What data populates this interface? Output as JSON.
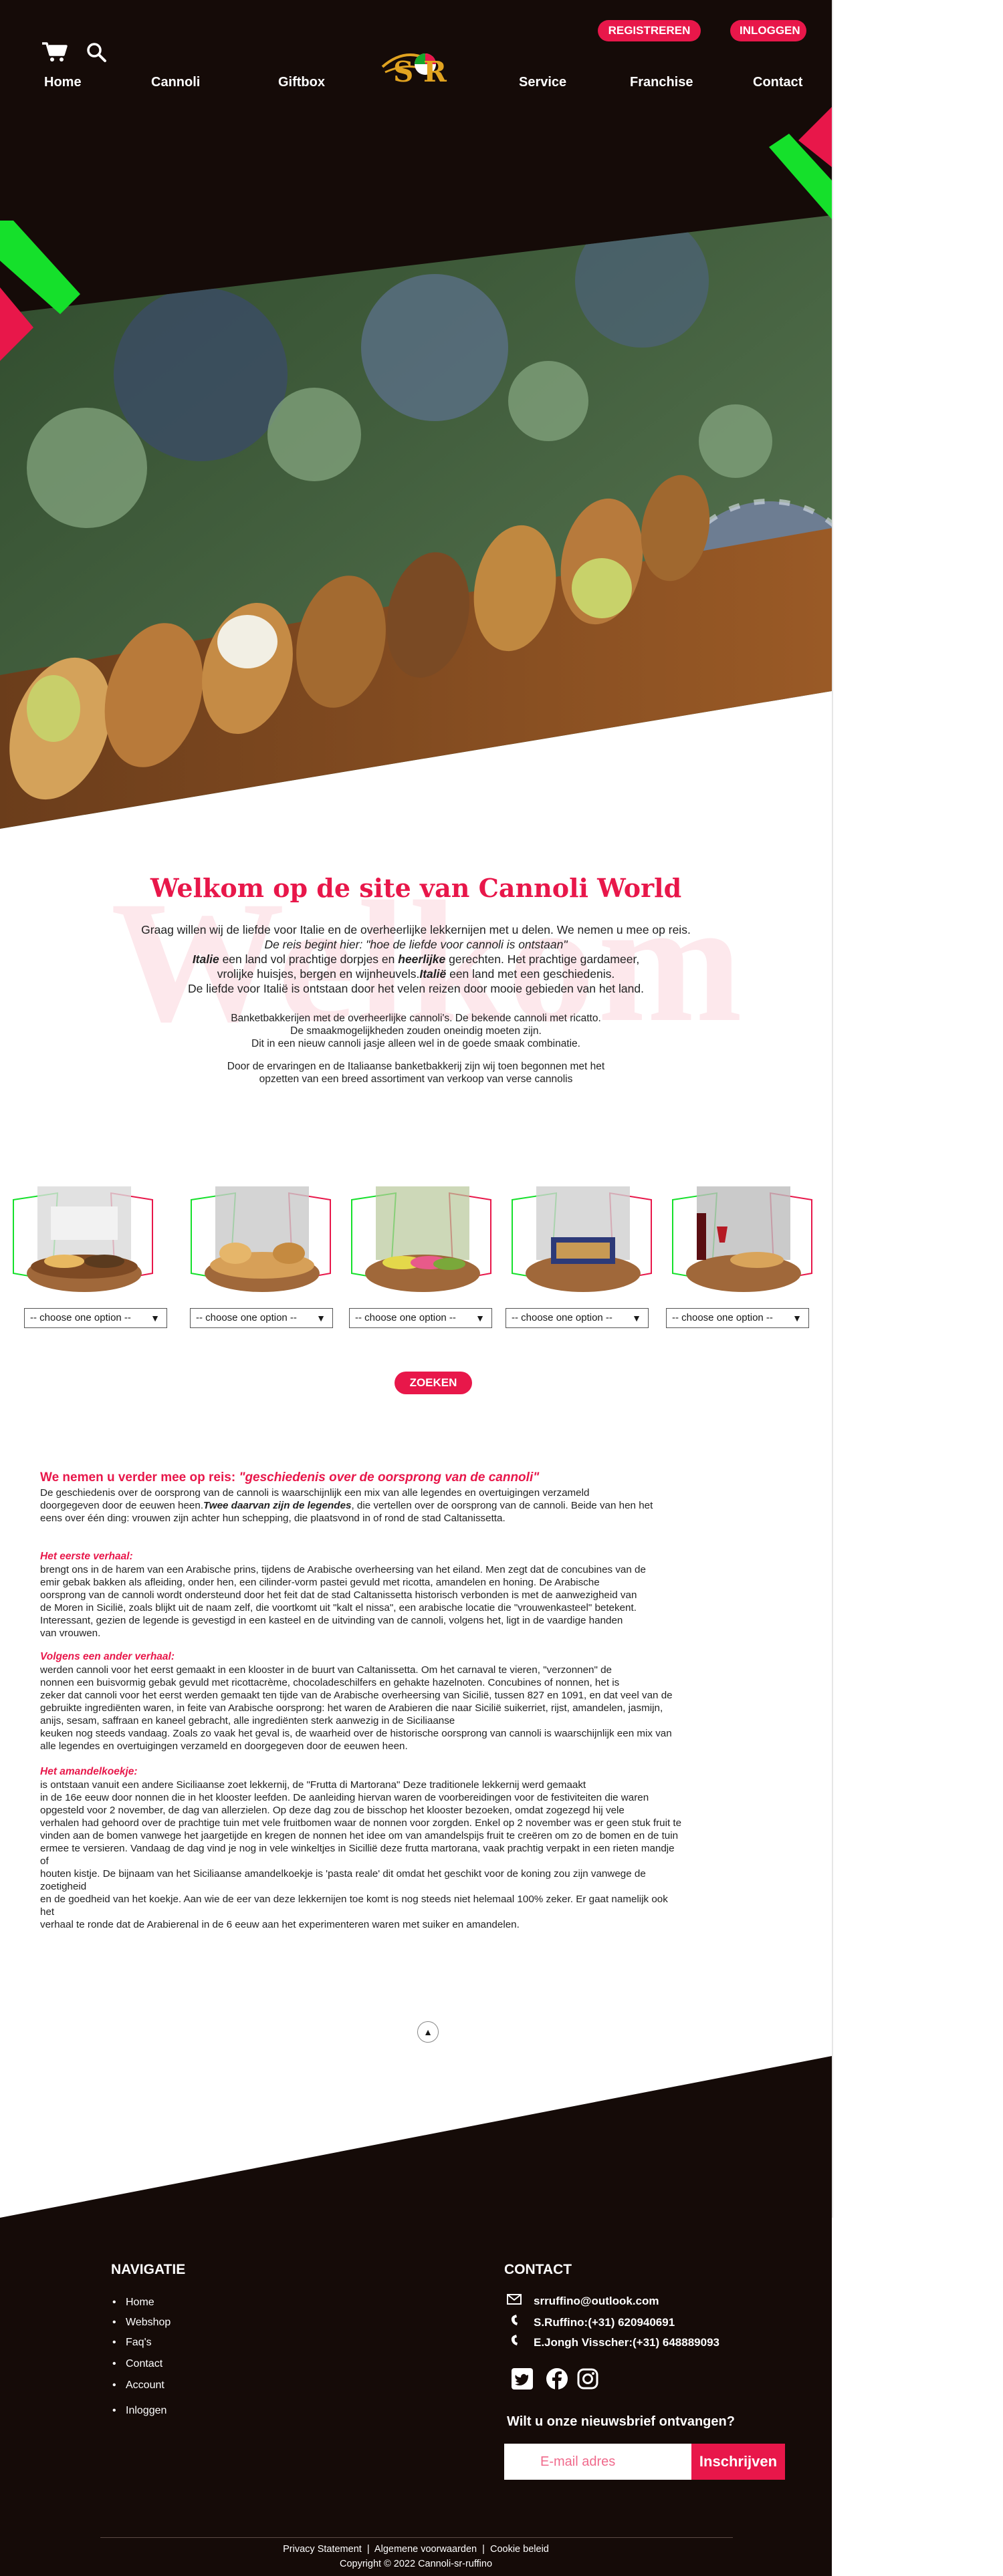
{
  "header": {
    "register_label": "REGISTREREN",
    "login_label": "INLOGGEN",
    "nav": [
      "Home",
      "Cannoli",
      "Giftbox",
      "Service",
      "Franchise",
      "Contact"
    ],
    "logo_letters": "S R"
  },
  "colors": {
    "accent": "#e8174a",
    "dark": "#150b08",
    "green": "#15e02b"
  },
  "welcome": {
    "watermark": "Welkom",
    "title": "Welkom op de site van Cannoli World",
    "p1_l1": "Graag willen wij de liefde voor Italie en de overheerlijke lekkernijen  met u delen. We nemen u mee op reis.",
    "p1_l2": "De reis begint hier: \"hoe de liefde voor cannoli is ontstaan\"",
    "p1_l3a": "Italie",
    "p1_l3b": " een land vol prachtige dorpjes en ",
    "p1_l3c": "heerlijke",
    "p1_l3d": " gerechten. Het prachtige gardameer,",
    "p1_l4a": "vrolijke huisjes, bergen en wijnheuvels.",
    "p1_l4b": "Italië",
    "p1_l4c": "  een land met een geschiedenis.",
    "p1_l5": "De liefde voor Italië is ontstaan door het velen reizen door mooie gebieden van het land.",
    "p2_l1": "Banketbakkerijen met de overheerlijke cannoli's. De bekende cannoli met ricatto.",
    "p2_l2": "De smaakmogelijkheden zouden oneindig moeten zijn.",
    "p2_l3": "Dit in een nieuw cannoli jasje alleen wel in de  goede smaak combinatie.",
    "p3_l1": "Door de ervaringen en de Italiaanse banketbakkerij zijn wij toen begonnen met het",
    "p3_l2": "opzetten van een breed assortiment van verkoop van verse cannolis"
  },
  "products": {
    "select_placeholder": "-- choose one option --",
    "select_arrow": "▼",
    "search_label": "ZOEKEN"
  },
  "history": {
    "h1a": "We nemen u verder mee op reis: ",
    "h1b": "\"geschiedenis over de oorsprong van de cannoli\"",
    "p1": "De geschiedenis over de oorsprong van de cannoli is waarschijnlijk een mix van alle legendes en overtuigingen verzameld",
    "p2a": "doorgegeven door de eeuwen heen.",
    "p2b": "Twee daarvan zijn de legendes",
    "p2c": ",  die vertellen over de oorsprong van de  cannoli. Beide van hen het",
    "p3": "eens over één ding: vrouwen zijn achter hun schepping, die plaatsvond in of rond de stad Caltanissetta.",
    "h2": "Het eerste verhaal:",
    "s2": [
      "brengt ons in de harem van een Arabische prins, tijdens de Arabische overheersing van het eiland. Men zegt dat de concubines van de",
      "emir gebak bakken als afleiding, onder hen, een cilinder-vorm pastei gevuld met ricotta, amandelen en honing. De Arabische",
      "oorsprong van de cannoli wordt ondersteund door het feit dat de stad Caltanissetta historisch verbonden is met de aanwezigheid van",
      "de Moren in Sicilië, zoals blijkt uit de naam zelf, die voortkomt uit \"kalt el nissa\", een arabische locatie die \"vrouwenkasteel\" betekent.",
      "Interessant, gezien de legende is gevestigd in een kasteel en de uitvinding van de cannoli, volgens het, ligt in de vaardige handen",
      "van vrouwen."
    ],
    "h3": "Volgens een ander verhaal:",
    "s3": [
      "werden cannoli voor het eerst gemaakt in een klooster in de buurt van Caltanissetta. Om het carnaval te vieren, \"verzonnen\" de",
      "nonnen een buisvormig gebak gevuld met ricottacrème, chocoladeschilfers en gehakte hazelnoten. Concubines of nonnen, het is",
      "zeker dat cannoli voor het eerst werden gemaakt ten tijde van de Arabische overheersing van Sicilië, tussen 827 en 1091, en dat veel van de",
      "gebruikte ingrediënten waren, in feite van Arabische oorsprong: het waren de Arabieren die naar Sicilië suikerriet, rijst, amandelen, jasmijn,",
      " anijs, sesam, saffraan en kaneel gebracht, alle ingrediënten sterk aanwezig in de Siciliaanse",
      "keuken nog steeds vandaag. Zoals zo vaak het geval is, de waarheid over de historische oorsprong van cannoli is waarschijnlijk een mix van",
      "alle legendes en overtuigingen verzameld en doorgegeven door de eeuwen heen."
    ],
    "h4": "Het amandelkoekje:",
    "s4": [
      "is ontstaan vanuit een andere Siciliaanse zoet lekkernij, de \"Frutta di Martorana\" Deze traditionele lekkernij werd gemaakt",
      "in de 16e eeuw door nonnen die in het klooster leefden. De aanleiding hiervan waren de voorbereidingen voor de festiviteiten die waren",
      "opgesteld voor 2 november, de dag van allerzielen. Op deze dag zou de bisschop het klooster bezoeken, omdat zogezegd hij vele",
      "verhalen had gehoord over de prachtige tuin met vele fruitbomen waar de nonnen voor zorgden. Enkel op 2 november was er geen stuk fruit te",
      "vinden aan de bomen vanwege het jaargetijde en kregen de nonnen het idee om van amandelspijs fruit te creëren om zo de bomen en de tuin",
      "ermee te versieren. Vandaag de dag vind je nog in vele winkeltjes in Sicillië deze frutta martorana, vaak prachtig verpakt in een rieten mandje of",
      "houten kistje. De bijnaam van het Siciliaanse amandelkoekje is 'pasta reale' dit omdat het geschikt voor de koning zou zijn vanwege de zoetigheid",
      "en de goedheid van  het koekje. Aan wie de eer van deze lekkernijen toe komt is nog steeds niet helemaal 100% zeker. Er gaat namelijk ook het",
      "verhaal te ronde dat de Arabierenal in de 6 eeuw aan het experimenteren waren met suiker en amandelen."
    ],
    "scroll_top": "▲"
  },
  "footer": {
    "nav_title": "NAVIGATIE",
    "nav_links": [
      "Home",
      "Webshop",
      "Faq's",
      "Contact",
      "Account",
      "Inloggen"
    ],
    "contact_title": "CONTACT",
    "email": "srruffino@outlook.com",
    "phone1": "S.Ruffino:(+31) 620940691",
    "phone2": "E.Jongh Visscher:(+31) 648889093",
    "newsletter_title": "Wilt u onze nieuwsbrief ontvangen?",
    "email_placeholder": "E-mail adres",
    "subscribe_label": "Inschrijven",
    "privacy": "Privacy Statement",
    "terms": "Algemene voorwaarden",
    "cookie": "Cookie beleid",
    "sep": "|",
    "copyright": "Copyright © 2022 Cannoli-sr-ruffino"
  }
}
